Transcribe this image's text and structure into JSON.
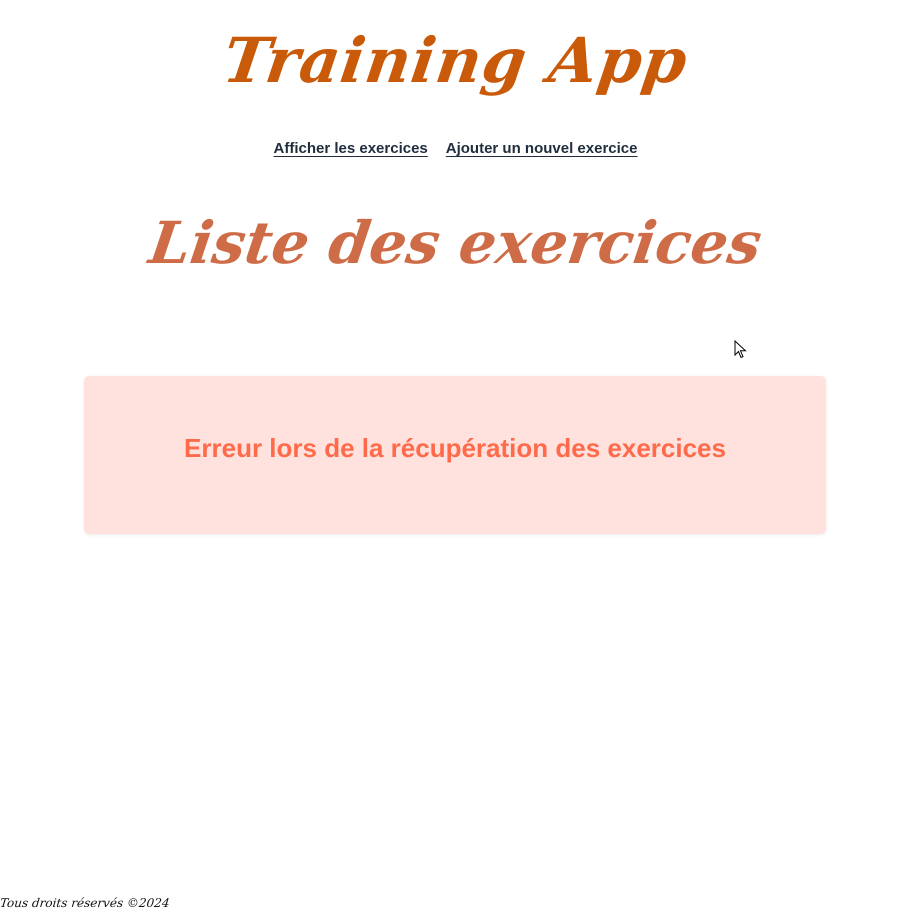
{
  "header": {
    "app_title": "Training App"
  },
  "nav": {
    "items": [
      {
        "label": "Afficher les exercices"
      },
      {
        "label": "Ajouter un nouvel exercice"
      }
    ]
  },
  "main": {
    "page_title": "Liste des exercices",
    "error_message": "Erreur lors de la récupération des exercices"
  },
  "footer": {
    "text": "Tous droits réservés ©2024"
  },
  "colors": {
    "brand": "#c95a0a",
    "title_accent": "#cd6c46",
    "nav_link": "#1f2d3d",
    "error_bg": "#ffe1dd",
    "error_text": "#ff6b4a"
  }
}
